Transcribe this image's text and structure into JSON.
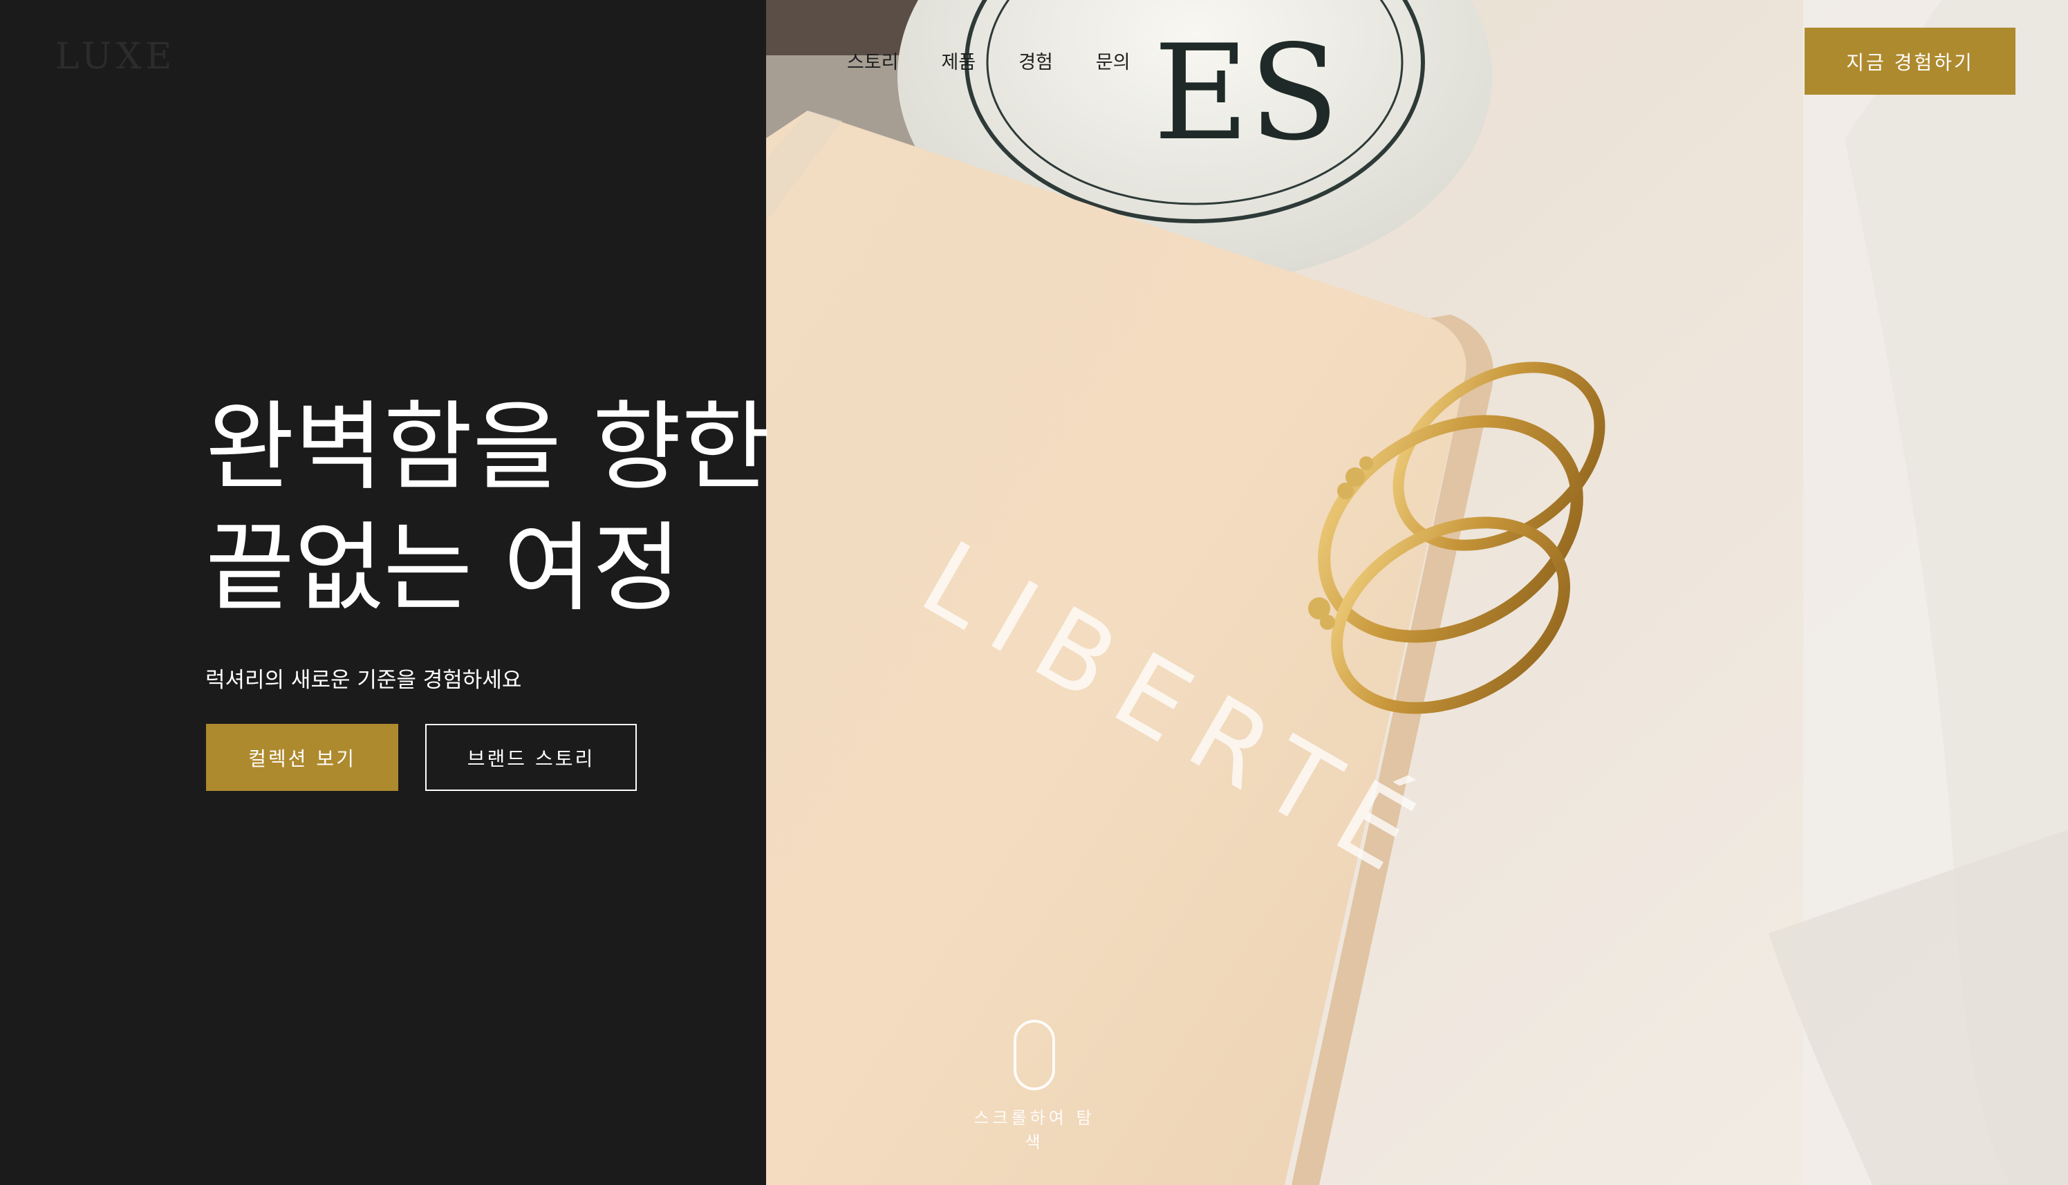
{
  "brand": {
    "logo_text": "LUXE"
  },
  "nav": {
    "items": [
      {
        "label": "스토리"
      },
      {
        "label": "제품"
      },
      {
        "label": "경험"
      },
      {
        "label": "문의"
      }
    ],
    "cta_label": "지금 경험하기"
  },
  "hero": {
    "title_line1": "완벽함을 향한",
    "title_line2": "끝없는 여정",
    "subtitle": "럭셔리의 새로운 기준을 경험하세요",
    "primary_button": "컬렉션 보기",
    "secondary_button": "브랜드 스토리",
    "image": {
      "box_text": "LIBERTÉ",
      "bottle_text": "ES"
    }
  },
  "scroll_hint": {
    "label": "스크롤하여 탐색"
  },
  "colors": {
    "accent": "#ae8a2e",
    "dark_panel": "#1b1b1b",
    "text_light": "#ffffff"
  }
}
